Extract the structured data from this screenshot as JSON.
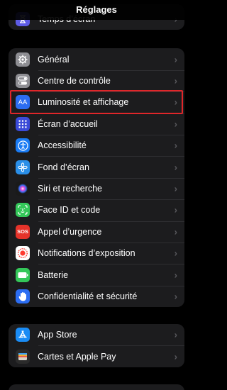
{
  "nav": {
    "title": "Réglages"
  },
  "top_partial": {
    "label": "Temps d’écran"
  },
  "group1": {
    "items": [
      {
        "label": "Général",
        "icon": "gear-icon",
        "color": "#8e8e93"
      },
      {
        "label": "Centre de contrôle",
        "icon": "toggles-icon",
        "color": "#8e8e93"
      },
      {
        "label": "Luminosité et affichage",
        "icon": "text-size-icon",
        "color": "#2c6df2",
        "icon_text": "AA"
      },
      {
        "label": "Écran d’accueil",
        "icon": "home-grid-icon",
        "color": "#3a4bd8"
      },
      {
        "label": "Accessibilité",
        "icon": "accessibility-icon",
        "color": "#1a7cf5"
      },
      {
        "label": "Fond d’écran",
        "icon": "flower-icon",
        "color": "#2a8fe8"
      },
      {
        "label": "Siri et recherche",
        "icon": "siri-icon",
        "color": "#1a1a1a"
      },
      {
        "label": "Face ID et code",
        "icon": "face-id-icon",
        "color": "#34c759"
      },
      {
        "label": "Appel d’urgence",
        "icon": "sos-icon",
        "color": "#e5332a",
        "icon_text": "SOS"
      },
      {
        "label": "Notifications d’exposition",
        "icon": "exposure-icon",
        "color": "#ffffff"
      },
      {
        "label": "Batterie",
        "icon": "battery-icon",
        "color": "#34c759"
      },
      {
        "label": "Confidentialité et sécurité",
        "icon": "hand-icon",
        "color": "#2c6df2"
      }
    ]
  },
  "group2": {
    "items": [
      {
        "label": "App Store",
        "icon": "app-store-icon",
        "color": "#1a8cf5"
      },
      {
        "label": "Cartes et Apple Pay",
        "icon": "wallet-icon",
        "color": "#2b2b2b"
      }
    ]
  },
  "chevron_glyph": "›"
}
